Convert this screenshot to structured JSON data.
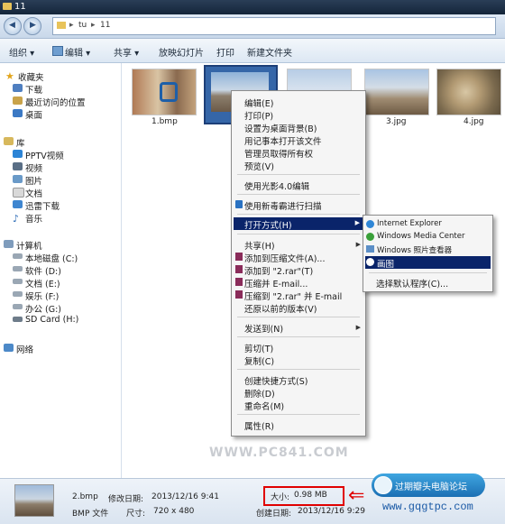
{
  "window": {
    "title": "11"
  },
  "address": {
    "segments": [
      "tu",
      "11"
    ],
    "sep": "▸"
  },
  "toolbar": {
    "organize": "组织 ▾",
    "edit": "编辑 ▾",
    "share": "共享 ▾",
    "slideshow": "放映幻灯片",
    "print": "打印",
    "new_folder": "新建文件夹"
  },
  "nav": {
    "favorites": "收藏夹",
    "downloads": "下载",
    "recent": "最近访问的位置",
    "desktop": "桌面",
    "libraries": "库",
    "pptv": "PPTV视频",
    "videos": "视频",
    "pictures": "图片",
    "documents": "文档",
    "xunlei": "迅雷下载",
    "music": "音乐",
    "computer": "计算机",
    "drive_c": "本地磁盘 (C:)",
    "drive_d": "软件 (D:)",
    "drive_e": "文档 (E:)",
    "drive_f": "娱乐 (F:)",
    "drive_g": "办公 (G:)",
    "drive_h": "SD Card (H:)",
    "network": "网络"
  },
  "files": [
    {
      "name": "1.bmp"
    },
    {
      "name": ""
    },
    {
      "name": ""
    },
    {
      "name": "3.jpg"
    },
    {
      "name": "4.jpg"
    }
  ],
  "context_menu": {
    "items": [
      "编辑(E)",
      "打印(P)",
      "设置为桌面背景(B)",
      "用记事本打开该文件",
      "管理员取得所有权",
      "预览(V)",
      "使用光影4.0编辑",
      "使用新毒霸进行扫描",
      "打开方式(H)",
      "共享(H)",
      "添加到压缩文件(A)...",
      "添加到 \"2.rar\"(T)",
      "压缩并 E-mail...",
      "压缩到 \"2.rar\" 并 E-mail",
      "还原以前的版本(V)",
      "发送到(N)",
      "剪切(T)",
      "复制(C)",
      "创建快捷方式(S)",
      "删除(D)",
      "重命名(M)",
      "属性(R)"
    ]
  },
  "submenu": {
    "items": [
      "Internet Explorer",
      "Windows Media Center",
      "Windows 照片查看器",
      "画图",
      "选择默认程序(C)..."
    ]
  },
  "watermark": {
    "main": "WWW.PC841.COM",
    "badge": "过期瓣头电脑论坛",
    "site": "www.gqgtpc.com"
  },
  "details": {
    "filename": "2.bmp",
    "type": "BMP 文件",
    "modified_label": "修改日期:",
    "modified": "2013/12/16 9:41",
    "dims_label": "尺寸:",
    "dims": "720 x 480",
    "size_label": "大小:",
    "size": "0.98 MB",
    "created_label": "创建日期:",
    "created": "2013/12/16 9:29"
  },
  "colors": {
    "highlight": "#0a246a",
    "annotation": "#e00000",
    "titlebar": "#1c2f48"
  }
}
